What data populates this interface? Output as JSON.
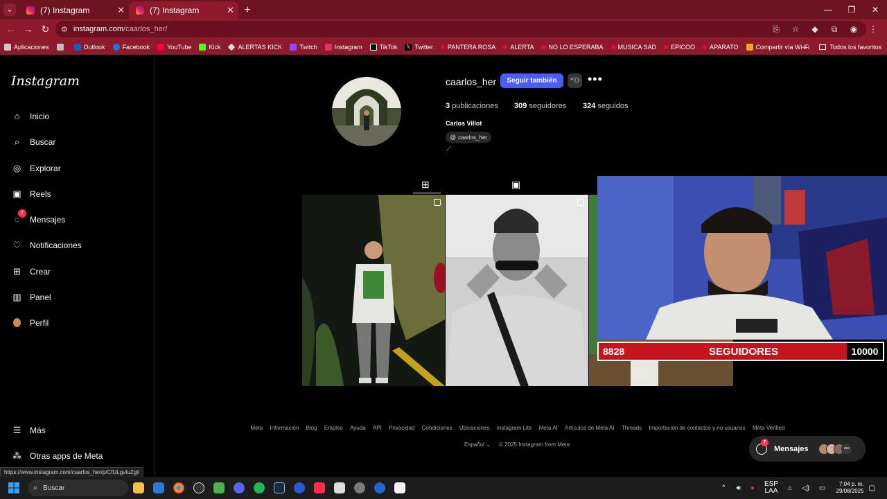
{
  "browser": {
    "tabs": [
      {
        "title": "(7) Instagram",
        "active": false
      },
      {
        "title": "(7) Instagram",
        "active": true
      }
    ],
    "url_host": "instagram.com",
    "url_path": "/caarlos_her/",
    "bookmarks": [
      {
        "label": "Aplicaciones",
        "color": "#e8e8e8"
      },
      {
        "label": "Outlook",
        "color": "#0a64c8"
      },
      {
        "label": "Facebook",
        "color": "#1877f2"
      },
      {
        "label": "YouTube",
        "color": "#ff0033"
      },
      {
        "label": "Kick",
        "color": "#53fc18"
      },
      {
        "label": "ALERTAS KICK",
        "color": "#dddddd"
      },
      {
        "label": "Twitch",
        "color": "#9146ff"
      },
      {
        "label": "Instagram",
        "color": "#e1306c"
      },
      {
        "label": "TikTok",
        "color": "#111111"
      },
      {
        "label": "Twitter",
        "color": "#ffffff"
      },
      {
        "label": "PANTERA ROSA",
        "color": "#ff0033"
      },
      {
        "label": "ALERTA",
        "color": "#ff0033"
      },
      {
        "label": "NO LO ESPERABA",
        "color": "#ff0033"
      },
      {
        "label": "MUSICA SAD",
        "color": "#ff0033"
      },
      {
        "label": "EPICOO",
        "color": "#ff0033"
      },
      {
        "label": "APARATO",
        "color": "#ff0033"
      },
      {
        "label": "Compartir vía Wi-Fi",
        "color": "#f5a623"
      }
    ],
    "bookmarks_more": "»",
    "all_bookmarks": "Todos los favoritos",
    "status_url": "https://www.instagram.com/caarlos_her/p/CfULgvIuZgl/"
  },
  "sidebar": {
    "logo": "Instagram",
    "items": [
      {
        "label": "Inicio",
        "icon": "home-icon",
        "glyph": "⌂"
      },
      {
        "label": "Buscar",
        "icon": "search-icon",
        "glyph": "⌕"
      },
      {
        "label": "Explorar",
        "icon": "compass-icon",
        "glyph": "◎"
      },
      {
        "label": "Reels",
        "icon": "reels-icon",
        "glyph": "▣"
      },
      {
        "label": "Mensajes",
        "icon": "messenger-icon",
        "glyph": "◌",
        "badge": "7"
      },
      {
        "label": "Notificaciones",
        "icon": "heart-icon",
        "glyph": "♡"
      },
      {
        "label": "Crear",
        "icon": "plus-icon",
        "glyph": "⊞"
      },
      {
        "label": "Panel",
        "icon": "dashboard-icon",
        "glyph": "▥"
      },
      {
        "label": "Perfil",
        "icon": "profile-avatar-icon",
        "glyph": "●"
      }
    ],
    "more": "Más",
    "meta_apps": "Otras apps de Meta"
  },
  "profile": {
    "username": "caarlos_her",
    "follow_label": "Seguir también",
    "posts_count": "3",
    "posts_label": "publicaciones",
    "followers_count": "309",
    "followers_label": "seguidores",
    "following_count": "324",
    "following_label": "seguidos",
    "full_name": "Carlos Villot",
    "threads_handle": "caarlos_her"
  },
  "overlay": {
    "current_followers": "8828",
    "label": "SEGUIDORES",
    "goal": "10000"
  },
  "footer": {
    "links": [
      "Meta",
      "Información",
      "Blog",
      "Empleo",
      "Ayuda",
      "API",
      "Privacidad",
      "Condiciones",
      "Ubicaciones",
      "Instagram Lite",
      "Meta AI",
      "Artículos de Meta AI",
      "Threads",
      "Importación de contactos y no usuarios",
      "Meta Verified"
    ],
    "language": "Español",
    "copyright": "© 2025 Instagram from Meta"
  },
  "messages_pill": {
    "label": "Mensajes",
    "badge": "7"
  },
  "taskbar": {
    "search_placeholder": "Buscar",
    "lang1": "ESP",
    "lang2": "LAA",
    "time": "7:04 p. m.",
    "date": "29/08/2025"
  }
}
